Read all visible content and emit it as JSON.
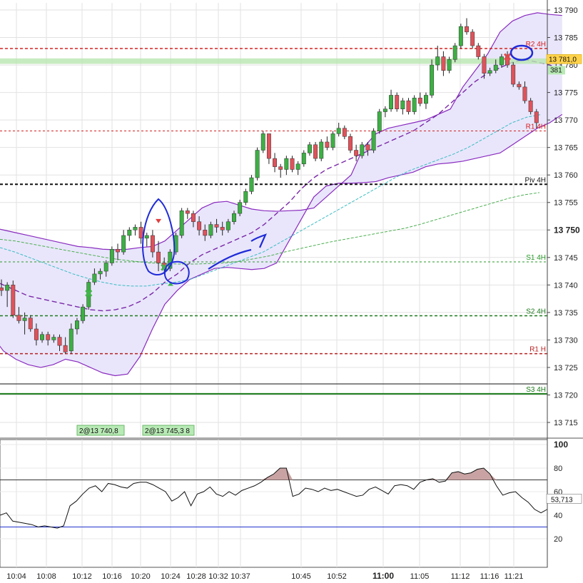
{
  "chart_data": [
    {
      "type": "candlestick",
      "title": "",
      "y_ticks": [
        "13 790",
        "13 785",
        "13 780",
        "13 775",
        "13 770",
        "13 765",
        "13 760",
        "13 755",
        "13 750",
        "13 745",
        "13 740",
        "13 735",
        "13 730",
        "13 725",
        "13 720",
        "13 715"
      ],
      "y_bold_tick": "13 750",
      "ylim": [
        13711,
        13792
      ],
      "x_ticks": [
        "10:04",
        "10:08",
        "10:12",
        "10:16",
        "10:20",
        "10:24",
        "10:28",
        "10:32",
        "10:37",
        "10:45",
        "10:52",
        "11:00",
        "11:05",
        "11:12",
        "11:16",
        "11:21"
      ],
      "x_bold_tick": "11:00",
      "last_price_label": "13 781,0",
      "last_price": 13781.0,
      "band_value_label": "381",
      "candles": [
        [
          13739.5,
          13741.0,
          13738.0,
          13739.0
        ],
        [
          13739.0,
          13740.5,
          13736.0,
          13740.0
        ],
        [
          13740.0,
          13740.8,
          13734.0,
          13734.5
        ],
        [
          13734.5,
          13736.0,
          13733.0,
          13733.5
        ],
        [
          13733.5,
          13735.0,
          13731.0,
          13734.0
        ],
        [
          13734.0,
          13734.5,
          13731.5,
          13732.0
        ],
        [
          13732.0,
          13733.0,
          13729.0,
          13730.0
        ],
        [
          13730.0,
          13731.5,
          13729.5,
          13731.0
        ],
        [
          13731.0,
          13731.5,
          13729.0,
          13730.0
        ],
        [
          13730.0,
          13731.0,
          13729.5,
          13730.5
        ],
        [
          13730.5,
          13731.0,
          13728.0,
          13729.0
        ],
        [
          13729.0,
          13730.5,
          13727.5,
          13727.8
        ],
        [
          13728.0,
          13733.0,
          13727.5,
          13732.0
        ],
        [
          13732.0,
          13734.0,
          13731.0,
          13733.5
        ],
        [
          13733.5,
          13736.5,
          13733.0,
          13736.0
        ],
        [
          13736.0,
          13741.0,
          13735.5,
          13740.5
        ],
        [
          13740.5,
          13743.0,
          13740.0,
          13742.0
        ],
        [
          13742.0,
          13743.0,
          13741.0,
          13742.5
        ],
        [
          13742.5,
          13744.5,
          13741.5,
          13744.0
        ],
        [
          13744.0,
          13747.0,
          13743.5,
          13746.5
        ],
        [
          13746.5,
          13747.5,
          13744.5,
          13746.0
        ],
        [
          13746.0,
          13750.0,
          13745.5,
          13749.0
        ],
        [
          13749.0,
          13750.5,
          13748.0,
          13750.0
        ],
        [
          13750.0,
          13751.0,
          13749.0,
          13750.5
        ],
        [
          13750.5,
          13751.5,
          13747.5,
          13748.5
        ],
        [
          13748.5,
          13749.5,
          13747.0,
          13749.0
        ],
        [
          13749.0,
          13750.0,
          13745.0,
          13746.0
        ],
        [
          13746.0,
          13748.0,
          13742.5,
          13744.0
        ],
        [
          13744.0,
          13745.0,
          13742.0,
          13743.0
        ],
        [
          13743.0,
          13746.5,
          13742.5,
          13746.0
        ],
        [
          13746.0,
          13749.5,
          13745.5,
          13749.0
        ],
        [
          13749.0,
          13754.0,
          13748.5,
          13753.5
        ],
        [
          13753.5,
          13754.0,
          13752.0,
          13753.0
        ],
        [
          13753.0,
          13753.5,
          13750.5,
          13751.5
        ],
        [
          13751.5,
          13752.5,
          13749.0,
          13750.0
        ],
        [
          13750.0,
          13751.0,
          13748.0,
          13749.0
        ],
        [
          13749.0,
          13751.5,
          13748.5,
          13751.0
        ],
        [
          13751.0,
          13752.0,
          13749.5,
          13750.5
        ],
        [
          13750.5,
          13751.5,
          13749.0,
          13750.0
        ],
        [
          13750.0,
          13752.0,
          13749.5,
          13751.5
        ],
        [
          13751.5,
          13753.5,
          13751.0,
          13753.0
        ],
        [
          13753.0,
          13755.5,
          13752.5,
          13755.0
        ],
        [
          13755.0,
          13757.5,
          13754.5,
          13757.0
        ],
        [
          13757.0,
          13760.0,
          13756.5,
          13759.5
        ],
        [
          13759.5,
          13765.0,
          13759.0,
          13764.5
        ],
        [
          13764.5,
          13768.0,
          13764.0,
          13767.5
        ],
        [
          13767.5,
          13767.5,
          13762.0,
          13763.0
        ],
        [
          13763.0,
          13764.0,
          13760.5,
          13761.5
        ],
        [
          13761.5,
          13762.0,
          13759.5,
          13761.0
        ],
        [
          13761.0,
          13763.5,
          13760.0,
          13763.0
        ],
        [
          13763.0,
          13763.5,
          13760.5,
          13761.0
        ],
        [
          13761.0,
          13762.5,
          13760.0,
          13762.0
        ],
        [
          13762.0,
          13764.5,
          13761.5,
          13764.0
        ],
        [
          13764.0,
          13766.0,
          13763.5,
          13765.5
        ],
        [
          13765.5,
          13766.0,
          13762.5,
          13763.0
        ],
        [
          13763.0,
          13766.5,
          13762.5,
          13766.0
        ],
        [
          13766.0,
          13767.0,
          13764.5,
          13765.0
        ],
        [
          13765.0,
          13768.0,
          13764.5,
          13767.5
        ],
        [
          13767.5,
          13769.5,
          13767.0,
          13768.5
        ],
        [
          13768.5,
          13769.0,
          13766.5,
          13767.0
        ],
        [
          13767.0,
          13767.5,
          13764.0,
          13764.5
        ],
        [
          13764.5,
          13765.5,
          13762.5,
          13763.5
        ],
        [
          13763.5,
          13766.0,
          13763.0,
          13765.5
        ],
        [
          13765.5,
          13766.0,
          13763.5,
          13764.5
        ],
        [
          13764.5,
          13768.5,
          13764.0,
          13768.0
        ],
        [
          13768.0,
          13772.0,
          13767.5,
          13771.5
        ],
        [
          13771.5,
          13772.5,
          13770.5,
          13772.0
        ],
        [
          13772.0,
          13775.5,
          13771.5,
          13774.5
        ],
        [
          13774.5,
          13775.0,
          13771.5,
          13772.0
        ],
        [
          13772.0,
          13774.0,
          13771.0,
          13773.5
        ],
        [
          13773.5,
          13774.0,
          13771.0,
          13771.5
        ],
        [
          13771.5,
          13774.5,
          13771.0,
          13774.0
        ],
        [
          13774.0,
          13775.0,
          13772.5,
          13773.0
        ],
        [
          13773.0,
          13775.0,
          13772.0,
          13774.5
        ],
        [
          13774.5,
          13781.0,
          13774.0,
          13780.0
        ],
        [
          13780.0,
          13783.5,
          13779.0,
          13781.5
        ],
        [
          13781.5,
          13782.5,
          13778.0,
          13779.0
        ],
        [
          13779.0,
          13781.5,
          13778.5,
          13781.0
        ],
        [
          13781.0,
          13784.0,
          13780.5,
          13783.5
        ],
        [
          13783.5,
          13787.5,
          13783.0,
          13787.0
        ],
        [
          13787.0,
          13788.5,
          13785.5,
          13786.0
        ],
        [
          13786.0,
          13786.5,
          13783.0,
          13783.5
        ],
        [
          13783.5,
          13784.0,
          13781.0,
          13781.5
        ],
        [
          13781.5,
          13782.0,
          13777.5,
          13778.5
        ],
        [
          13778.5,
          13779.5,
          13778.0,
          13779.0
        ],
        [
          13779.0,
          13781.0,
          13778.5,
          13780.0
        ],
        [
          13780.0,
          13782.0,
          13779.5,
          13781.5
        ],
        [
          13781.5,
          13782.5,
          13779.5,
          13780.0
        ],
        [
          13780.0,
          13780.5,
          13776.0,
          13776.5
        ],
        [
          13776.5,
          13777.0,
          13775.5,
          13776.0
        ],
        [
          13776.0,
          13777.0,
          13773.0,
          13773.5
        ],
        [
          13773.5,
          13774.0,
          13771.0,
          13771.5
        ],
        [
          13771.5,
          13772.0,
          13768.5,
          13769.5
        ]
      ],
      "bands": {
        "upper": [
          13751,
          13750.5,
          13750,
          13749.5,
          13749,
          13748.5,
          13748,
          13747.5,
          13747,
          13746.8,
          13746.5,
          13746.4,
          13746.5,
          13746.8,
          13747,
          13748,
          13750,
          13752,
          13754,
          13755,
          13755.2,
          13754.5,
          13753.8,
          13753.5,
          13753.4,
          13753.5,
          13753.6,
          13754,
          13756,
          13758,
          13760,
          13765,
          13767.5,
          13768.5,
          13769,
          13769.5,
          13770,
          13771,
          13772,
          13776,
          13779,
          13782,
          13786,
          13788,
          13789,
          13789.5,
          13789.2,
          13789
        ],
        "lower": [
          13734,
          13731,
          13728,
          13726.5,
          13725.5,
          13725,
          13725.5,
          13726.5,
          13726,
          13725,
          13724,
          13723.5,
          13723.8,
          13727,
          13732,
          13736.5,
          13739,
          13741,
          13742,
          13743,
          13743.2,
          13743,
          13742.8,
          13743,
          13744,
          13748,
          13752,
          13756,
          13758,
          13758.5,
          13758.5,
          13758.6,
          13758.8,
          13759.5,
          13760,
          13760.5,
          13761.5,
          13762,
          13762.2,
          13762.5,
          13763,
          13763.5,
          13764,
          13765.5,
          13767,
          13768.5,
          13769.5,
          13771
        ],
        "mid": [
          13742,
          13741,
          13740,
          13739,
          13738,
          13737.5,
          13737,
          13736.5,
          13736,
          13735.5,
          13735.3,
          13735.5,
          13736,
          13737,
          13738.5,
          13740.5,
          13742,
          13744,
          13745.5,
          13746.5,
          13747.5,
          13748.5,
          13749.5,
          13751,
          13753,
          13755,
          13757.5,
          13759.5,
          13761,
          13762,
          13763,
          13764,
          13765,
          13766,
          13767,
          13768,
          13769.5,
          13771,
          13773,
          13775,
          13777,
          13778.5,
          13779.5,
          13780.5,
          13781,
          13780.5,
          13780,
          13779
        ]
      },
      "ma_fast": [
        13746.8,
        13746,
        13745,
        13744,
        13743,
        13742,
        13741.2,
        13740.5,
        13740,
        13739.8,
        13739.8,
        13740.2,
        13740.5,
        13741,
        13742,
        13743,
        13744,
        13745,
        13746,
        13747.5,
        13749,
        13750.5,
        13752,
        13753.5,
        13755,
        13756.5,
        13758,
        13759.5,
        13760.8,
        13761.8,
        13762.8,
        13763.8,
        13765,
        13766.5,
        13768,
        13769.5,
        13770.5,
        13771
      ],
      "ma_slow": [
        13748.3,
        13748,
        13747.5,
        13747,
        13746.5,
        13746,
        13745.5,
        13745,
        13744.6,
        13744.3,
        13744,
        13743.9,
        13743.8,
        13743.8,
        13743.9,
        13744,
        13744.3,
        13744.8,
        13745.3,
        13746,
        13746.6,
        13747.2,
        13747.8,
        13748.3,
        13748.8,
        13749.3,
        13749.8,
        13750.3,
        13751,
        13751.8,
        13752.6,
        13753.4,
        13754.2,
        13755,
        13755.8,
        13756.4,
        13756.8
      ],
      "levels": [
        {
          "label": "R2 4H",
          "value": 13783.0,
          "color": "#d62020",
          "dash": "4,3",
          "width": 1.5
        },
        {
          "label": "R1 4H",
          "value": 13768.0,
          "color": "#d62020",
          "dash": "3,3",
          "width": 1
        },
        {
          "label": "Piv 4H",
          "value": 13758.3,
          "color": "#111111",
          "dash": "4,3",
          "width": 2
        },
        {
          "label": "S1 4H",
          "value": 13744.2,
          "color": "#2a9a2a",
          "dash": "3,3",
          "width": 1
        },
        {
          "label": "S2 4H",
          "value": 13734.4,
          "color": "#1e7a1e",
          "dash": "4,3",
          "width": 1.5
        },
        {
          "label": "R1 H",
          "value": 13727.5,
          "color": "#b82020",
          "dash": "4,3",
          "width": 1.5
        },
        {
          "label": "S3 4H",
          "value": 13720.2,
          "color": "#1a7a1a",
          "dash": "",
          "width": 2
        },
        {
          "label": "",
          "value": 13722.0,
          "color": "#111111",
          "dash": "",
          "width": 1
        }
      ],
      "green_band": [
        13780.2,
        13781.2
      ],
      "signal_buy_index": 29,
      "signal_sell_index": 27,
      "signal_x1_index": 15,
      "signal_x2_index": 28,
      "signal_x3_index": 87,
      "trade_boxes": [
        "2@13 740,8",
        "2@13 745,3 8"
      ]
    },
    {
      "type": "line",
      "title": "",
      "ylim": [
        5,
        103
      ],
      "y_ticks": [
        "100",
        "80",
        "60",
        "40",
        "20"
      ],
      "last_value_label": "53,713",
      "last_value": 53.713,
      "overbought": 70,
      "oversold": 30,
      "values": [
        40,
        42,
        35,
        34,
        33,
        32,
        30,
        31,
        30,
        29,
        31,
        48,
        52,
        58,
        63,
        65,
        60,
        67,
        66,
        64,
        63,
        67,
        68,
        68,
        66,
        63,
        60,
        52,
        55,
        60,
        48,
        58,
        60,
        64,
        58,
        56,
        60,
        57,
        61,
        63,
        65,
        68,
        72,
        75,
        80,
        80,
        56,
        58,
        63,
        62,
        60,
        63,
        61,
        62,
        60,
        58,
        56,
        57,
        62,
        64,
        61,
        58,
        65,
        66,
        65,
        62,
        68,
        70,
        71,
        68,
        69,
        76,
        77,
        75,
        76,
        79,
        80,
        75,
        65,
        57,
        59,
        60,
        55,
        51,
        45,
        42,
        45
      ]
    }
  ]
}
